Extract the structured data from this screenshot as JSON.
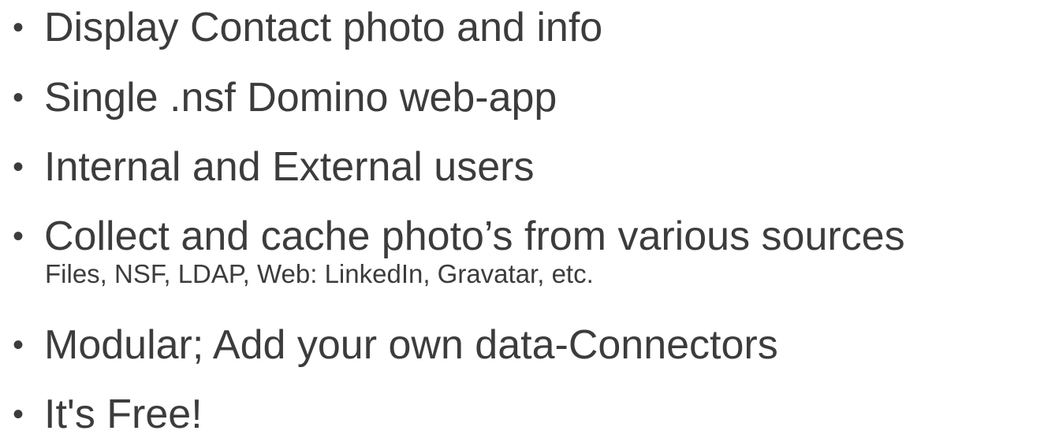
{
  "bullets": [
    {
      "text": "Display Contact photo and info"
    },
    {
      "text": "Single .nsf Domino web-app"
    },
    {
      "text": "Internal and External users"
    },
    {
      "text": "Collect and cache photo’s from various sources",
      "sub": "Files, NSF, LDAP, Web: LinkedIn, Gravatar, etc."
    },
    {
      "text": "Modular; Add your own data-Connectors"
    },
    {
      "text": "It's Free!"
    }
  ],
  "bullet_glyph": "•",
  "colors": {
    "text": "#3c3c3c",
    "background": "#ffffff"
  }
}
